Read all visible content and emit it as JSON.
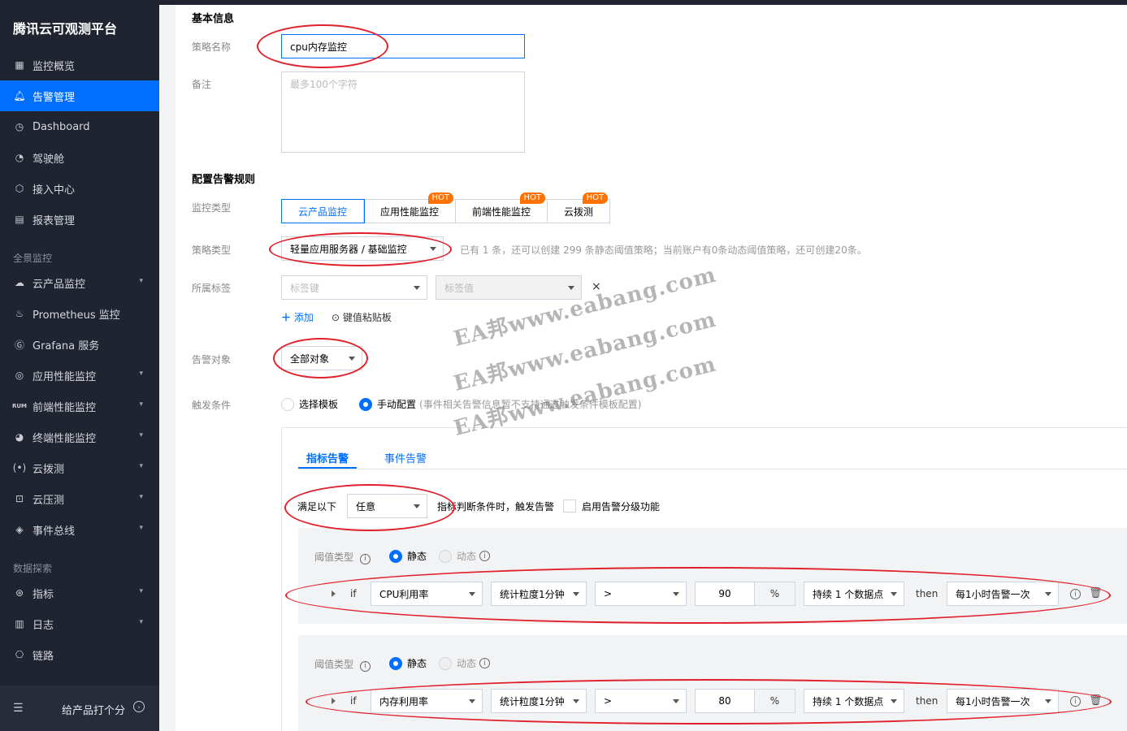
{
  "sidebar": {
    "brand": "腾讯云可观测平台",
    "items": [
      {
        "label": "监控概览",
        "icon": "grid-icon",
        "active": false
      },
      {
        "label": "告警管理",
        "icon": "bell-icon",
        "active": true
      },
      {
        "label": "Dashboard",
        "icon": "clock-icon",
        "active": false
      },
      {
        "label": "驾驶舱",
        "icon": "gauge-icon",
        "active": false
      },
      {
        "label": "接入中心",
        "icon": "cube-icon",
        "active": false
      },
      {
        "label": "报表管理",
        "icon": "report-icon",
        "active": false
      }
    ],
    "group1": "全景监控",
    "group1_items": [
      {
        "label": "云产品监控",
        "icon": "cloud-icon",
        "has_arrow": true
      },
      {
        "label": "Prometheus 监控",
        "icon": "prometheus-icon",
        "has_arrow": false
      },
      {
        "label": "Grafana 服务",
        "icon": "grafana-icon",
        "has_arrow": false
      },
      {
        "label": "应用性能监控",
        "icon": "apm-icon",
        "has_arrow": true
      },
      {
        "label": "前端性能监控",
        "icon": "rum-icon",
        "has_arrow": true
      },
      {
        "label": "终端性能监控",
        "icon": "terminal-icon",
        "has_arrow": true
      },
      {
        "label": "云拨测",
        "icon": "probe-icon",
        "has_arrow": true
      },
      {
        "label": "云压测",
        "icon": "stress-icon",
        "has_arrow": true
      },
      {
        "label": "事件总线",
        "icon": "layers-icon",
        "has_arrow": true
      }
    ],
    "group2": "数据探索",
    "group2_items": [
      {
        "label": "指标",
        "icon": "metric-icon",
        "has_arrow": true
      },
      {
        "label": "日志",
        "icon": "log-icon",
        "has_arrow": true
      },
      {
        "label": "链路",
        "icon": "trace-icon",
        "has_arrow": false
      }
    ],
    "footer_label": "给产品打个分"
  },
  "basic": {
    "title": "基本信息",
    "name_label": "策略名称",
    "name_value": "cpu内存监控",
    "remark_label": "备注",
    "remark_placeholder": "最多100个字符"
  },
  "rules": {
    "title": "配置告警规则",
    "monitor_type_label": "监控类型",
    "monitor_types": [
      {
        "label": "云产品监控",
        "hot": false,
        "active": true
      },
      {
        "label": "应用性能监控",
        "hot": true,
        "active": false
      },
      {
        "label": "前端性能监控",
        "hot": true,
        "active": false
      },
      {
        "label": "云拨测",
        "hot": true,
        "active": false
      }
    ],
    "hot_badge": "HOT",
    "policy_type_label": "策略类型",
    "policy_type_value": "轻量应用服务器 / 基础监控",
    "policy_hint": "已有 1 条，还可以创建 299 条静态阈值策略；当前账户有0条动态阈值策略，还可创建20条。",
    "tag_label": "所属标签",
    "tag_key_placeholder": "标签键",
    "tag_value_placeholder": "标签值",
    "tag_remove": "×",
    "add_link": "添加",
    "paste_link": "键值粘贴板",
    "target_label": "告警对象",
    "target_value": "全部对象",
    "trigger_label": "触发条件",
    "trigger_template": "选择模板",
    "trigger_manual": "手动配置",
    "trigger_manual_note": "(事件相关告警信息暂不支持通过触发条件模板配置)"
  },
  "panel": {
    "tabs": [
      "指标告警",
      "事件告警"
    ],
    "satisfy_label": "满足以下",
    "satisfy_value": "任意",
    "satisfy_suffix": "指标判断条件时，触发告警",
    "level_label": "启用告警分级功能",
    "conditions": [
      {
        "threshold_label": "阈值类型",
        "static": "静态",
        "dynamic": "动态",
        "if": "if",
        "metric": "CPU利用率",
        "period": "统计粒度1分钟",
        "operator": ">",
        "value": "90",
        "unit": "%",
        "duration": "持续 1 个数据点",
        "then": "then",
        "frequency": "每1小时告警一次"
      },
      {
        "threshold_label": "阈值类型",
        "static": "静态",
        "dynamic": "动态",
        "if": "if",
        "metric": "内存利用率",
        "period": "统计粒度1分钟",
        "operator": ">",
        "value": "80",
        "unit": "%",
        "duration": "持续 1 个数据点",
        "then": "then",
        "frequency": "每1小时告警一次"
      }
    ]
  },
  "watermark": "EA邦www.eabang.com",
  "colors": {
    "accent": "#006eff",
    "sidebar_bg": "#1f2430",
    "hot": "#ff7200",
    "annotation": "#e0202b"
  }
}
